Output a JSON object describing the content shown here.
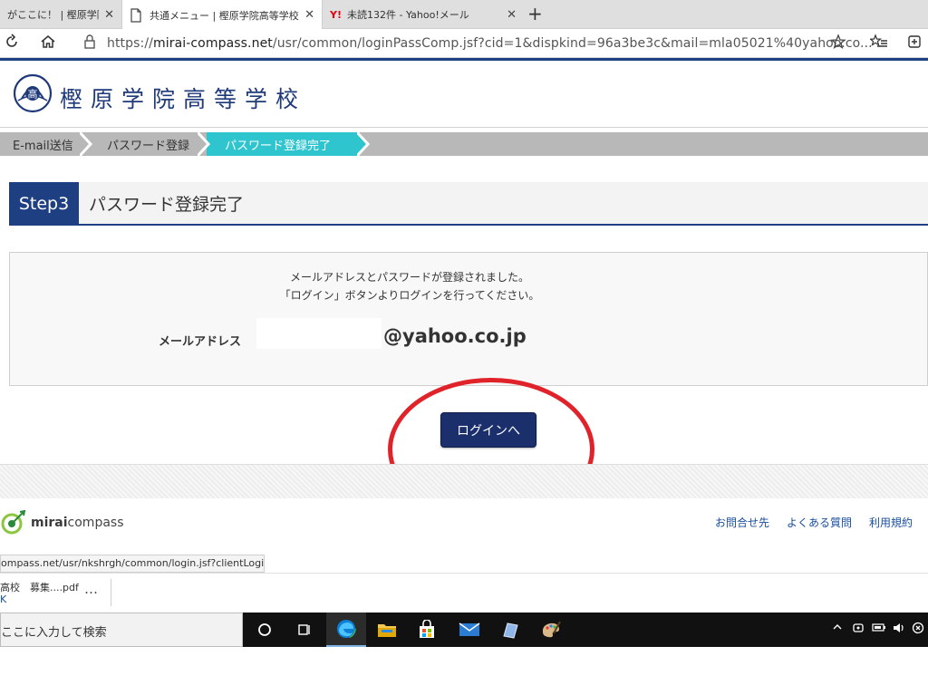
{
  "browser": {
    "tabs": [
      {
        "title": "がここに！ | 樫原学院高"
      },
      {
        "title": "共通メニュー | 樫原学院高等学校"
      },
      {
        "title": "未読132件 - Yahoo!メール"
      }
    ],
    "tab_close_glyph": "✕",
    "new_tab_glyph": "+",
    "yahoo_favicon": "Y!",
    "url_prefix": "https://",
    "url_host": "mirai-compass.net",
    "url_rest": "/usr/common/loginPassComp.jsf?cid=1&dispkind=96a3be3c&mail=mla05021%40yahoo.co..."
  },
  "site": {
    "school_name": "樫原学院高等学校",
    "logo_char": "高"
  },
  "steps": [
    {
      "label": "E-mail送信"
    },
    {
      "label": "パスワード登録"
    },
    {
      "label": "パスワード登録完了"
    }
  ],
  "step_heading": {
    "badge": "Step3",
    "title": "パスワード登録完了"
  },
  "message": {
    "line1": "メールアドレスとパスワードが登録されました。",
    "line2": "「ログイン」ボタンよりログインを行ってください。",
    "email_label": "メールアドレス",
    "email_domain": "@yahoo.co.jp"
  },
  "login_button_label": "ログインへ",
  "footer": {
    "logo_bold": "mirai",
    "logo_light": "compass",
    "links": [
      "お問合せ先",
      "よくある質問",
      "利用規約"
    ]
  },
  "status_url": "ompass.net/usr/nkshrgh/common/login.jsf?clientLoginToken=",
  "downloads": {
    "file_name": "高校　募集....pdf",
    "open_link": "K",
    "more": "…"
  },
  "taskbar": {
    "search_placeholder": "ここに入力して検索"
  },
  "colors": {
    "brand_navy": "#1f3f83",
    "step_active": "#2fc5cf",
    "annotation_red": "#e0222a",
    "link_blue": "#1a4fa0"
  }
}
